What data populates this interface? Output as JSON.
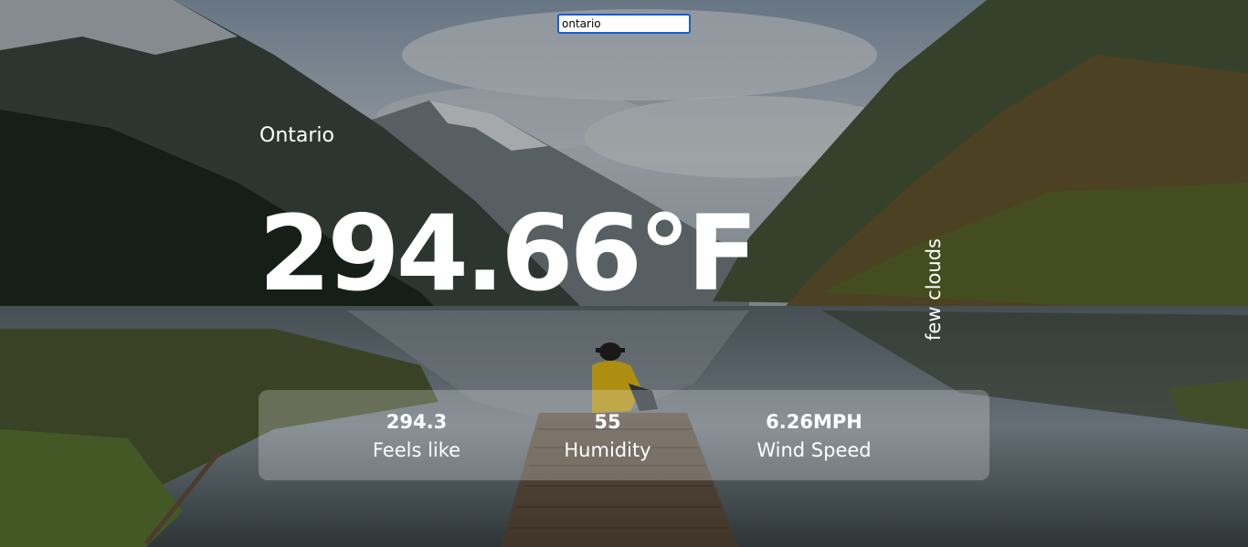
{
  "search": {
    "value": "ontario",
    "placeholder": ""
  },
  "weather": {
    "city": "Ontario",
    "temperature": "294.66°F",
    "description": "few clouds"
  },
  "stats": {
    "feels_like": {
      "value": "294.3",
      "label": "Feels like"
    },
    "humidity": {
      "value": "55",
      "label": "Humidity"
    },
    "wind_speed": {
      "value": "6.26MPH",
      "label": "Wind Speed"
    }
  },
  "background": {
    "subject": "mountain lake with wooden dock and person in yellow jacket"
  }
}
